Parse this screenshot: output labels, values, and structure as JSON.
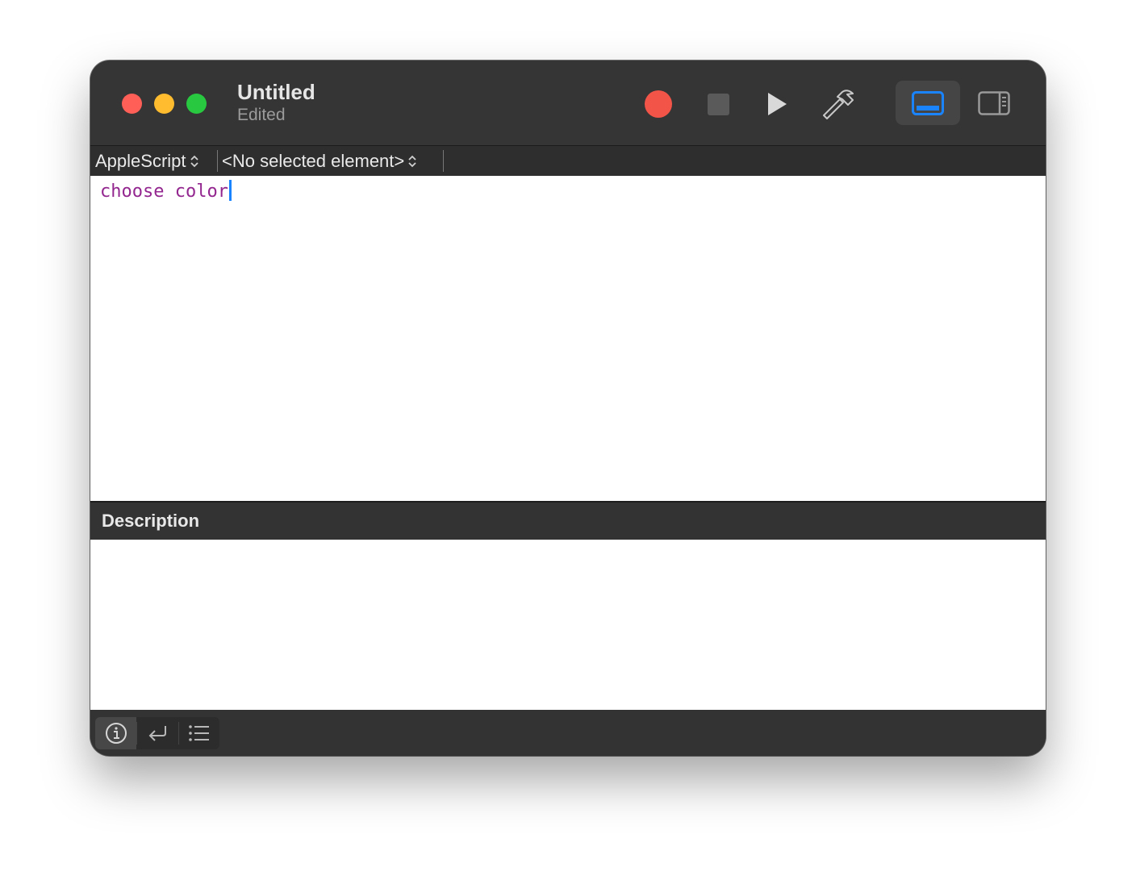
{
  "window": {
    "title": "Untitled",
    "subtitle": "Edited"
  },
  "toolbar": {
    "record_icon": "record-icon",
    "stop_icon": "stop-icon",
    "run_icon": "play-icon",
    "compile_icon": "hammer-icon",
    "view_bottom_icon": "bottom-panel-icon",
    "view_side_icon": "sidebar-icon",
    "accent": "#1a84ff",
    "record_color": "#f25448"
  },
  "navbar": {
    "language": "AppleScript",
    "element": "<No selected element>"
  },
  "editor": {
    "code": "choose color",
    "keyword_color": "#93278f"
  },
  "description_panel": {
    "title": "Description"
  },
  "bottom_bar": {
    "buttons": [
      "info-icon",
      "reply-icon",
      "list-icon"
    ]
  }
}
